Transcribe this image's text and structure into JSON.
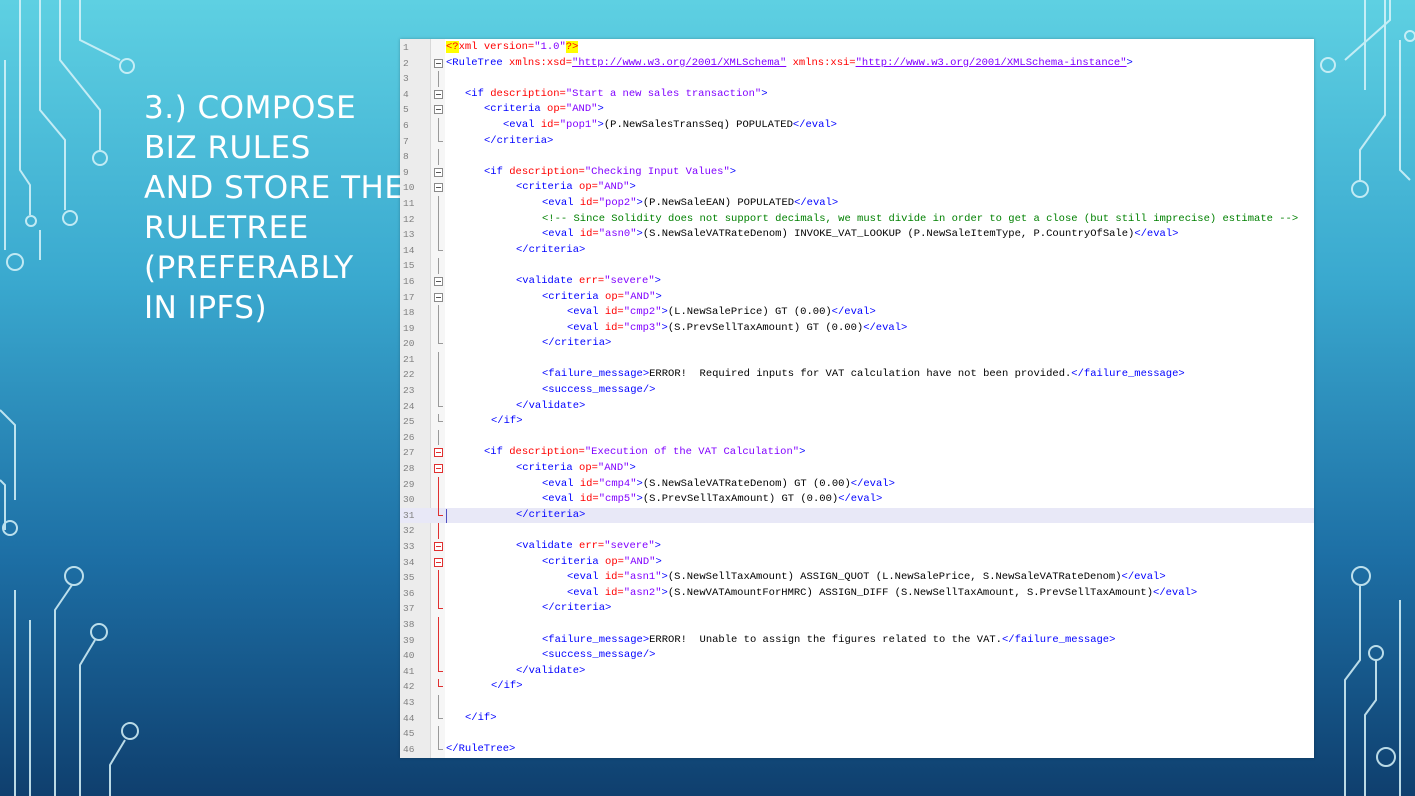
{
  "slide": {
    "title_lines": [
      "3.) COMPOSE",
      "BIZ RULES",
      "AND STORE THE",
      "RULETREE",
      "(PREFERABLY",
      "IN IPFS)"
    ]
  },
  "editor": {
    "current_line": 31,
    "lines": [
      {
        "n": "1",
        "fold": "none",
        "indent": 0,
        "tokens": [
          {
            "t": "pi",
            "v": "<?"
          },
          {
            "t": "attr",
            "v": "xml version="
          },
          {
            "t": "val",
            "v": "\"1.0\""
          },
          {
            "t": "pi",
            "v": "?>"
          }
        ]
      },
      {
        "n": "2",
        "fold": "box",
        "indent": 0,
        "tokens": [
          {
            "t": "tag",
            "v": "<RuleTree "
          },
          {
            "t": "attr",
            "v": "xmlns:xsd="
          },
          {
            "t": "url",
            "v": "\"http://www.w3.org/2001/XMLSchema\""
          },
          {
            "t": "attr",
            "v": " xmlns:xsi="
          },
          {
            "t": "url",
            "v": "\"http://www.w3.org/2001/XMLSchema-instance\""
          },
          {
            "t": "tag",
            "v": ">"
          }
        ]
      },
      {
        "n": "3",
        "fold": "line",
        "indent": 0,
        "tokens": []
      },
      {
        "n": "4",
        "fold": "box",
        "indent": 19,
        "tokens": [
          {
            "t": "tag",
            "v": "<if "
          },
          {
            "t": "attr",
            "v": "description="
          },
          {
            "t": "val",
            "v": "\"Start a new sales transaction\""
          },
          {
            "t": "tag",
            "v": ">"
          }
        ]
      },
      {
        "n": "5",
        "fold": "box",
        "indent": 38,
        "tokens": [
          {
            "t": "tag",
            "v": "<criteria "
          },
          {
            "t": "attr",
            "v": "op="
          },
          {
            "t": "val",
            "v": "\"AND\""
          },
          {
            "t": "tag",
            "v": ">"
          }
        ]
      },
      {
        "n": "6",
        "fold": "line",
        "indent": 57,
        "tokens": [
          {
            "t": "tag",
            "v": "<eval "
          },
          {
            "t": "attr",
            "v": "id="
          },
          {
            "t": "val",
            "v": "\"pop1\""
          },
          {
            "t": "tag",
            "v": ">"
          },
          {
            "t": "txt",
            "v": "(P.NewSalesTransSeq) POPULATED"
          },
          {
            "t": "tag",
            "v": "</eval>"
          }
        ]
      },
      {
        "n": "7",
        "fold": "end",
        "indent": 38,
        "tokens": [
          {
            "t": "tag",
            "v": "</criteria>"
          }
        ]
      },
      {
        "n": "8",
        "fold": "line",
        "indent": 0,
        "tokens": []
      },
      {
        "n": "9",
        "fold": "box",
        "indent": 38,
        "tokens": [
          {
            "t": "tag",
            "v": "<if "
          },
          {
            "t": "attr",
            "v": "description="
          },
          {
            "t": "val",
            "v": "\"Checking Input Values\""
          },
          {
            "t": "tag",
            "v": ">"
          }
        ]
      },
      {
        "n": "10",
        "fold": "box",
        "indent": 70,
        "tokens": [
          {
            "t": "tag",
            "v": "<criteria "
          },
          {
            "t": "attr",
            "v": "op="
          },
          {
            "t": "val",
            "v": "\"AND\""
          },
          {
            "t": "tag",
            "v": ">"
          }
        ]
      },
      {
        "n": "11",
        "fold": "line",
        "indent": 96,
        "tokens": [
          {
            "t": "tag",
            "v": "<eval "
          },
          {
            "t": "attr",
            "v": "id="
          },
          {
            "t": "val",
            "v": "\"pop2\""
          },
          {
            "t": "tag",
            "v": ">"
          },
          {
            "t": "txt",
            "v": "(P.NewSaleEAN) POPULATED"
          },
          {
            "t": "tag",
            "v": "</eval>"
          }
        ]
      },
      {
        "n": "12",
        "fold": "line",
        "indent": 96,
        "tokens": [
          {
            "t": "com",
            "v": "<!-- Since Solidity does not support decimals, we must divide in order to get a close (but still imprecise) estimate -->"
          }
        ]
      },
      {
        "n": "13",
        "fold": "line",
        "indent": 96,
        "tokens": [
          {
            "t": "tag",
            "v": "<eval "
          },
          {
            "t": "attr",
            "v": "id="
          },
          {
            "t": "val",
            "v": "\"asn0\""
          },
          {
            "t": "tag",
            "v": ">"
          },
          {
            "t": "txt",
            "v": "(S.NewSaleVATRateDenom) INVOKE_VAT_LOOKUP (P.NewSaleItemType, P.CountryOfSale)"
          },
          {
            "t": "tag",
            "v": "</eval>"
          }
        ]
      },
      {
        "n": "14",
        "fold": "end",
        "indent": 70,
        "tokens": [
          {
            "t": "tag",
            "v": "</criteria>"
          }
        ]
      },
      {
        "n": "15",
        "fold": "line",
        "indent": 0,
        "tokens": []
      },
      {
        "n": "16",
        "fold": "box",
        "indent": 70,
        "tokens": [
          {
            "t": "tag",
            "v": "<validate "
          },
          {
            "t": "attr",
            "v": "err="
          },
          {
            "t": "val",
            "v": "\"severe\""
          },
          {
            "t": "tag",
            "v": ">"
          }
        ]
      },
      {
        "n": "17",
        "fold": "box",
        "indent": 96,
        "tokens": [
          {
            "t": "tag",
            "v": "<criteria "
          },
          {
            "t": "attr",
            "v": "op="
          },
          {
            "t": "val",
            "v": "\"AND\""
          },
          {
            "t": "tag",
            "v": ">"
          }
        ]
      },
      {
        "n": "18",
        "fold": "line",
        "indent": 121,
        "tokens": [
          {
            "t": "tag",
            "v": "<eval "
          },
          {
            "t": "attr",
            "v": "id="
          },
          {
            "t": "val",
            "v": "\"cmp2\""
          },
          {
            "t": "tag",
            "v": ">"
          },
          {
            "t": "txt",
            "v": "(L.NewSalePrice) GT (0.00)"
          },
          {
            "t": "tag",
            "v": "</eval>"
          }
        ]
      },
      {
        "n": "19",
        "fold": "line",
        "indent": 121,
        "tokens": [
          {
            "t": "tag",
            "v": "<eval "
          },
          {
            "t": "attr",
            "v": "id="
          },
          {
            "t": "val",
            "v": "\"cmp3\""
          },
          {
            "t": "tag",
            "v": ">"
          },
          {
            "t": "txt",
            "v": "(S.PrevSellTaxAmount) GT (0.00)"
          },
          {
            "t": "tag",
            "v": "</eval>"
          }
        ]
      },
      {
        "n": "20",
        "fold": "end",
        "indent": 96,
        "tokens": [
          {
            "t": "tag",
            "v": "</criteria>"
          }
        ]
      },
      {
        "n": "21",
        "fold": "line",
        "indent": 0,
        "tokens": []
      },
      {
        "n": "22",
        "fold": "line",
        "indent": 96,
        "tokens": [
          {
            "t": "tag",
            "v": "<failure_message>"
          },
          {
            "t": "txt",
            "v": "ERROR!  Required inputs for VAT calculation have not been provided."
          },
          {
            "t": "tag",
            "v": "</failure_message>"
          }
        ]
      },
      {
        "n": "23",
        "fold": "line",
        "indent": 96,
        "tokens": [
          {
            "t": "tag",
            "v": "<success_message/>"
          }
        ]
      },
      {
        "n": "24",
        "fold": "end",
        "indent": 70,
        "tokens": [
          {
            "t": "tag",
            "v": "</validate>"
          }
        ]
      },
      {
        "n": "25",
        "fold": "end",
        "indent": 45,
        "tokens": [
          {
            "t": "tag",
            "v": "</if>"
          }
        ]
      },
      {
        "n": "26",
        "fold": "line",
        "indent": 0,
        "tokens": []
      },
      {
        "n": "27",
        "fold": "boxred",
        "indent": 38,
        "tokens": [
          {
            "t": "tag",
            "v": "<if "
          },
          {
            "t": "attr",
            "v": "description="
          },
          {
            "t": "val",
            "v": "\"Execution of the VAT Calculation\""
          },
          {
            "t": "tag",
            "v": ">"
          }
        ]
      },
      {
        "n": "28",
        "fold": "boxred",
        "indent": 70,
        "tokens": [
          {
            "t": "tag",
            "v": "<criteria "
          },
          {
            "t": "attr",
            "v": "op="
          },
          {
            "t": "val",
            "v": "\"AND\""
          },
          {
            "t": "tag",
            "v": ">"
          }
        ]
      },
      {
        "n": "29",
        "fold": "linered",
        "indent": 96,
        "tokens": [
          {
            "t": "tag",
            "v": "<eval "
          },
          {
            "t": "attr",
            "v": "id="
          },
          {
            "t": "val",
            "v": "\"cmp4\""
          },
          {
            "t": "tag",
            "v": ">"
          },
          {
            "t": "txt",
            "v": "(S.NewSaleVATRateDenom) GT (0.00)"
          },
          {
            "t": "tag",
            "v": "</eval>"
          }
        ]
      },
      {
        "n": "30",
        "fold": "linered",
        "indent": 96,
        "tokens": [
          {
            "t": "tag",
            "v": "<eval "
          },
          {
            "t": "attr",
            "v": "id="
          },
          {
            "t": "val",
            "v": "\"cmp5\""
          },
          {
            "t": "tag",
            "v": ">"
          },
          {
            "t": "txt",
            "v": "(S.PrevSellTaxAmount) GT (0.00)"
          },
          {
            "t": "tag",
            "v": "</eval>"
          }
        ]
      },
      {
        "n": "31",
        "fold": "endred",
        "indent": 70,
        "tokens": [
          {
            "t": "tag",
            "v": "</criteria>"
          }
        ]
      },
      {
        "n": "32",
        "fold": "linered",
        "indent": 0,
        "tokens": []
      },
      {
        "n": "33",
        "fold": "boxred",
        "indent": 70,
        "tokens": [
          {
            "t": "tag",
            "v": "<validate "
          },
          {
            "t": "attr",
            "v": "err="
          },
          {
            "t": "val",
            "v": "\"severe\""
          },
          {
            "t": "tag",
            "v": ">"
          }
        ]
      },
      {
        "n": "34",
        "fold": "boxred",
        "indent": 96,
        "tokens": [
          {
            "t": "tag",
            "v": "<criteria "
          },
          {
            "t": "attr",
            "v": "op="
          },
          {
            "t": "val",
            "v": "\"AND\""
          },
          {
            "t": "tag",
            "v": ">"
          }
        ]
      },
      {
        "n": "35",
        "fold": "linered",
        "indent": 121,
        "tokens": [
          {
            "t": "tag",
            "v": "<eval "
          },
          {
            "t": "attr",
            "v": "id="
          },
          {
            "t": "val",
            "v": "\"asn1\""
          },
          {
            "t": "tag",
            "v": ">"
          },
          {
            "t": "txt",
            "v": "(S.NewSellTaxAmount) ASSIGN_QUOT (L.NewSalePrice, S.NewSaleVATRateDenom)"
          },
          {
            "t": "tag",
            "v": "</eval>"
          }
        ]
      },
      {
        "n": "36",
        "fold": "linered",
        "indent": 121,
        "tokens": [
          {
            "t": "tag",
            "v": "<eval "
          },
          {
            "t": "attr",
            "v": "id="
          },
          {
            "t": "val",
            "v": "\"asn2\""
          },
          {
            "t": "tag",
            "v": ">"
          },
          {
            "t": "txt",
            "v": "(S.NewVATAmountForHMRC) ASSIGN_DIFF (S.NewSellTaxAmount, S.PrevSellTaxAmount)"
          },
          {
            "t": "tag",
            "v": "</eval>"
          }
        ]
      },
      {
        "n": "37",
        "fold": "endred",
        "indent": 96,
        "tokens": [
          {
            "t": "tag",
            "v": "</criteria>"
          }
        ]
      },
      {
        "n": "38",
        "fold": "linered",
        "indent": 0,
        "tokens": []
      },
      {
        "n": "39",
        "fold": "linered",
        "indent": 96,
        "tokens": [
          {
            "t": "tag",
            "v": "<failure_message>"
          },
          {
            "t": "txt",
            "v": "ERROR!  Unable to assign the figures related to the VAT."
          },
          {
            "t": "tag",
            "v": "</failure_message>"
          }
        ]
      },
      {
        "n": "40",
        "fold": "linered",
        "indent": 96,
        "tokens": [
          {
            "t": "tag",
            "v": "<success_message/>"
          }
        ]
      },
      {
        "n": "41",
        "fold": "endred",
        "indent": 70,
        "tokens": [
          {
            "t": "tag",
            "v": "</validate>"
          }
        ]
      },
      {
        "n": "42",
        "fold": "endred",
        "indent": 45,
        "tokens": [
          {
            "t": "tag",
            "v": "</if>"
          }
        ]
      },
      {
        "n": "43",
        "fold": "line",
        "indent": 0,
        "tokens": []
      },
      {
        "n": "44",
        "fold": "end",
        "indent": 19,
        "tokens": [
          {
            "t": "tag",
            "v": "</if>"
          }
        ]
      },
      {
        "n": "45",
        "fold": "line",
        "indent": 0,
        "tokens": []
      },
      {
        "n": "46",
        "fold": "end",
        "indent": 0,
        "tokens": [
          {
            "t": "tag",
            "v": "</RuleTree>"
          }
        ]
      }
    ]
  },
  "colors": {
    "tag": "#0000ff",
    "attribute": "#ff0000",
    "value": "#8000ff",
    "comment": "#008000",
    "current_line": "#e8e8f7",
    "fold_marker_changed": "#e03030"
  }
}
